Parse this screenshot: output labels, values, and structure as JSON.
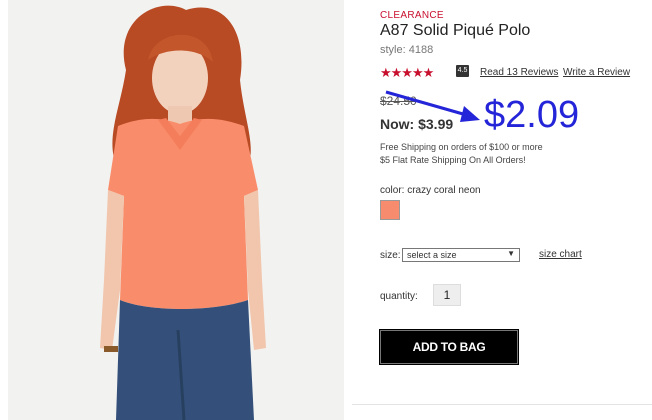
{
  "product": {
    "label": "CLEARANCE",
    "title": "A87 Solid Piqué Polo",
    "style": "style: 4188",
    "stars": "★★★★★",
    "rating": "4.5",
    "read_reviews": "Read 13 Reviews",
    "write_review": "Write a Review",
    "price_was": "$24.50",
    "price_now": "Now: $3.99",
    "shipping_line1": "Free Shipping on orders of $100 or more",
    "shipping_line2": "$5 Flat Rate Shipping On All Orders!",
    "color_label": "color: crazy coral neon",
    "size_label": "size:",
    "size_select": "select a size",
    "size_chart": "size chart",
    "quantity_label": "quantity:",
    "quantity_value": "1",
    "add_to_bag": "ADD TO BAG"
  },
  "annotation": {
    "price": "$2.09",
    "color": "#2424d8"
  },
  "colors": {
    "accent": "#c8102e",
    "swatch": "#f78b6e"
  }
}
